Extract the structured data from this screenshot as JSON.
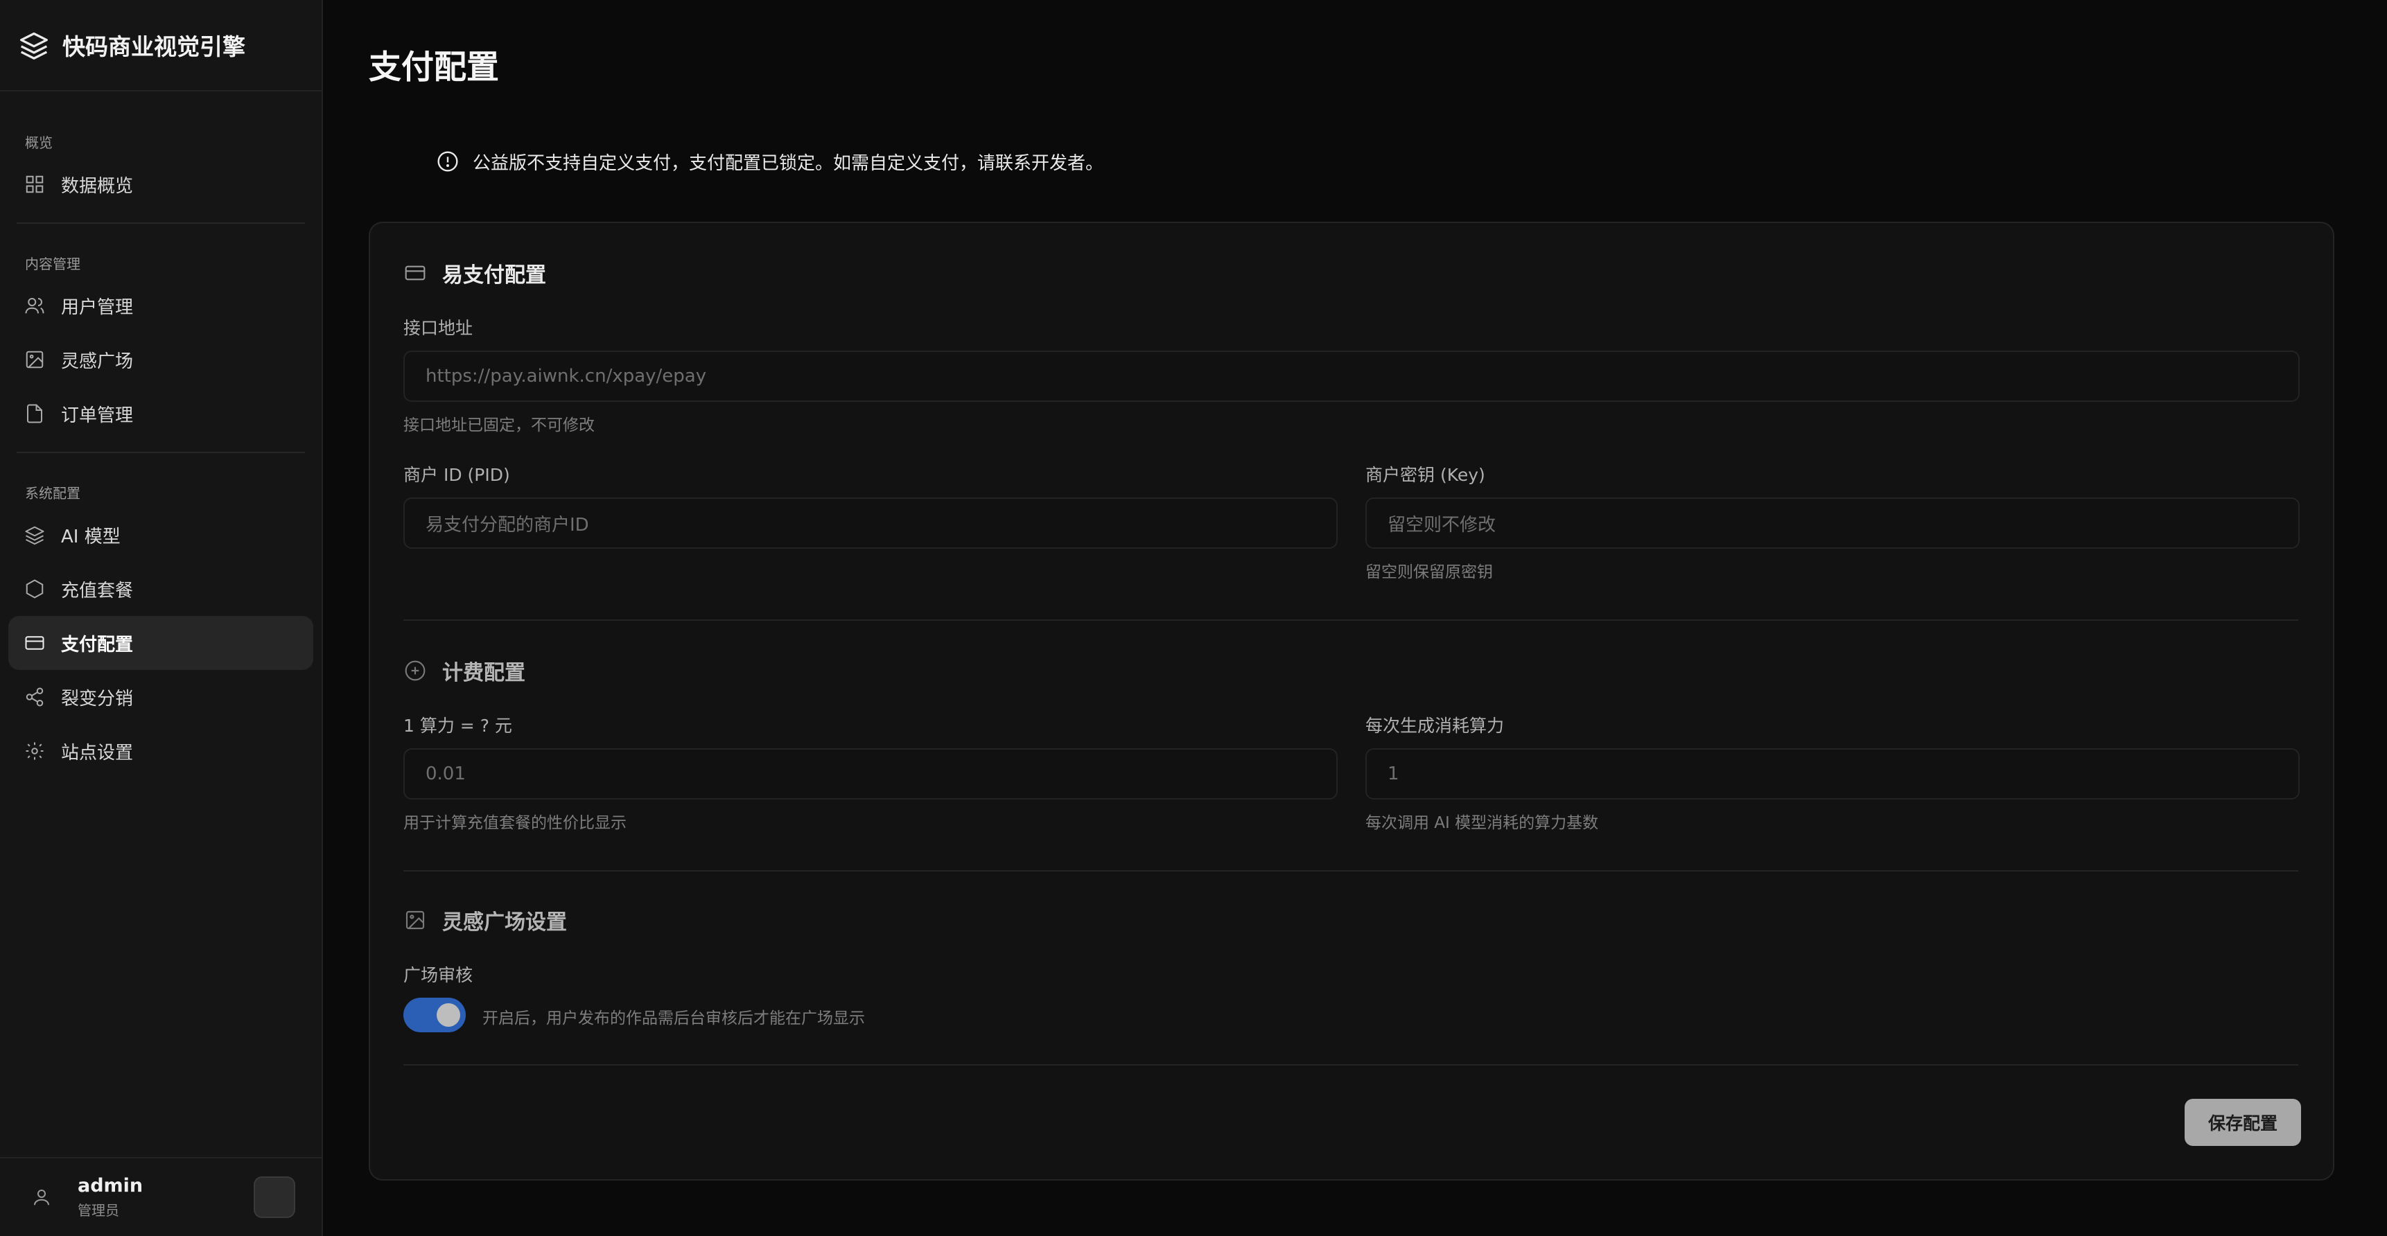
{
  "app": {
    "title": "快码商业视觉引擎"
  },
  "sidebar": {
    "groups": [
      {
        "title": "概览",
        "items": [
          {
            "label": "数据概览",
            "icon": "grid-icon"
          }
        ]
      },
      {
        "title": "内容管理",
        "items": [
          {
            "label": "用户管理",
            "icon": "users-icon"
          },
          {
            "label": "灵感广场",
            "icon": "image-icon"
          },
          {
            "label": "订单管理",
            "icon": "file-icon"
          }
        ]
      },
      {
        "title": "系统配置",
        "items": [
          {
            "label": "AI 模型",
            "icon": "layers-icon"
          },
          {
            "label": "充值套餐",
            "icon": "hexagon-icon"
          },
          {
            "label": "支付配置",
            "icon": "credit-card-icon",
            "active": true
          },
          {
            "label": "裂变分销",
            "icon": "share-icon"
          },
          {
            "label": "站点设置",
            "icon": "gear-icon"
          }
        ]
      }
    ],
    "user": {
      "name": "admin",
      "role": "管理员"
    }
  },
  "page": {
    "title": "支付配置",
    "notice": "公益版不支持自定义支付，支付配置已锁定。如需自定义支付，请联系开发者。"
  },
  "epay": {
    "title": "易支付配置",
    "api_label": "接口地址",
    "api_value": "https://pay.aiwnk.cn/xpay/epay",
    "api_hint": "接口地址已固定，不可修改",
    "pid_label": "商户 ID (PID)",
    "pid_placeholder": "易支付分配的商户ID",
    "key_label": "商户密钥 (Key)",
    "key_placeholder": "留空则不修改",
    "key_hint": "留空则保留原密钥"
  },
  "billing": {
    "title": "计费配置",
    "rate_label": "1 算力 = ? 元",
    "rate_value": "0.01",
    "rate_hint": "用于计算充值套餐的性价比显示",
    "cost_label": "每次生成消耗算力",
    "cost_value": "1",
    "cost_hint": "每次调用 AI 模型消耗的算力基数"
  },
  "plaza": {
    "title": "灵感广场设置",
    "review_label": "广场审核",
    "review_enabled": true,
    "review_hint": "开启后，用户发布的作品需后台审核后才能在广场显示"
  },
  "actions": {
    "save_label": "保存配置"
  },
  "colors": {
    "accent": "#2b5fb5",
    "background": "#0a0a0a",
    "card": "#121212"
  }
}
